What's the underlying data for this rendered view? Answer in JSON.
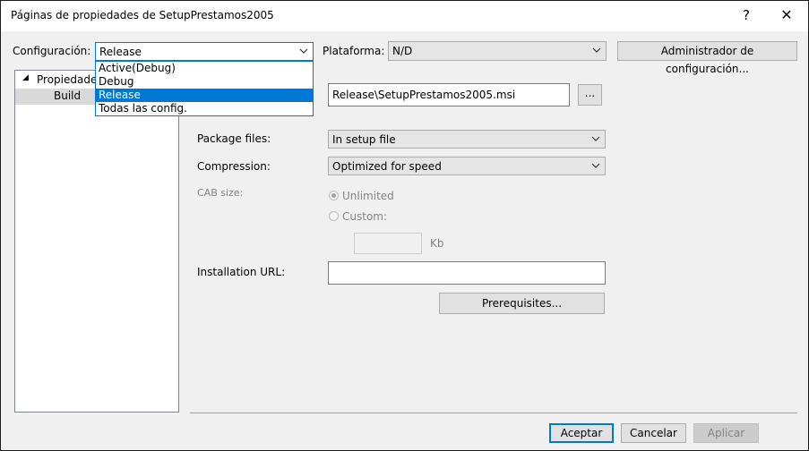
{
  "window": {
    "title": "Páginas de propiedades de SetupPrestamos2005",
    "help": "?",
    "close": "✕"
  },
  "config": {
    "label": "Configuración:",
    "value": "Release",
    "options": [
      "Active(Debug)",
      "Debug",
      "Release",
      "Todas las config."
    ],
    "selected_index": 2
  },
  "platform": {
    "label": "Plataforma:",
    "value": "N/D"
  },
  "config_manager_button": "Administrador de configuración...",
  "tree": {
    "root": "Propiedades",
    "child": "Build",
    "expand_glyph": "◢"
  },
  "output_file": {
    "value": "Release\\SetupPrestamos2005.msi",
    "browse_label": "..."
  },
  "package_files": {
    "label": "Package files:",
    "value": "In setup file"
  },
  "compression": {
    "label": "Compression:",
    "value": "Optimized for speed"
  },
  "cab_size": {
    "label": "CAB size:",
    "unlimited": "Unlimited",
    "custom": "Custom:",
    "unit": "Kb"
  },
  "installation_url": {
    "label": "Installation URL:",
    "value": ""
  },
  "prerequisites_button": "Prerequisites...",
  "footer": {
    "ok": "Aceptar",
    "cancel": "Cancelar",
    "apply": "Aplicar"
  },
  "colors": {
    "accent": "#0078d7",
    "disabled": "#838383"
  }
}
